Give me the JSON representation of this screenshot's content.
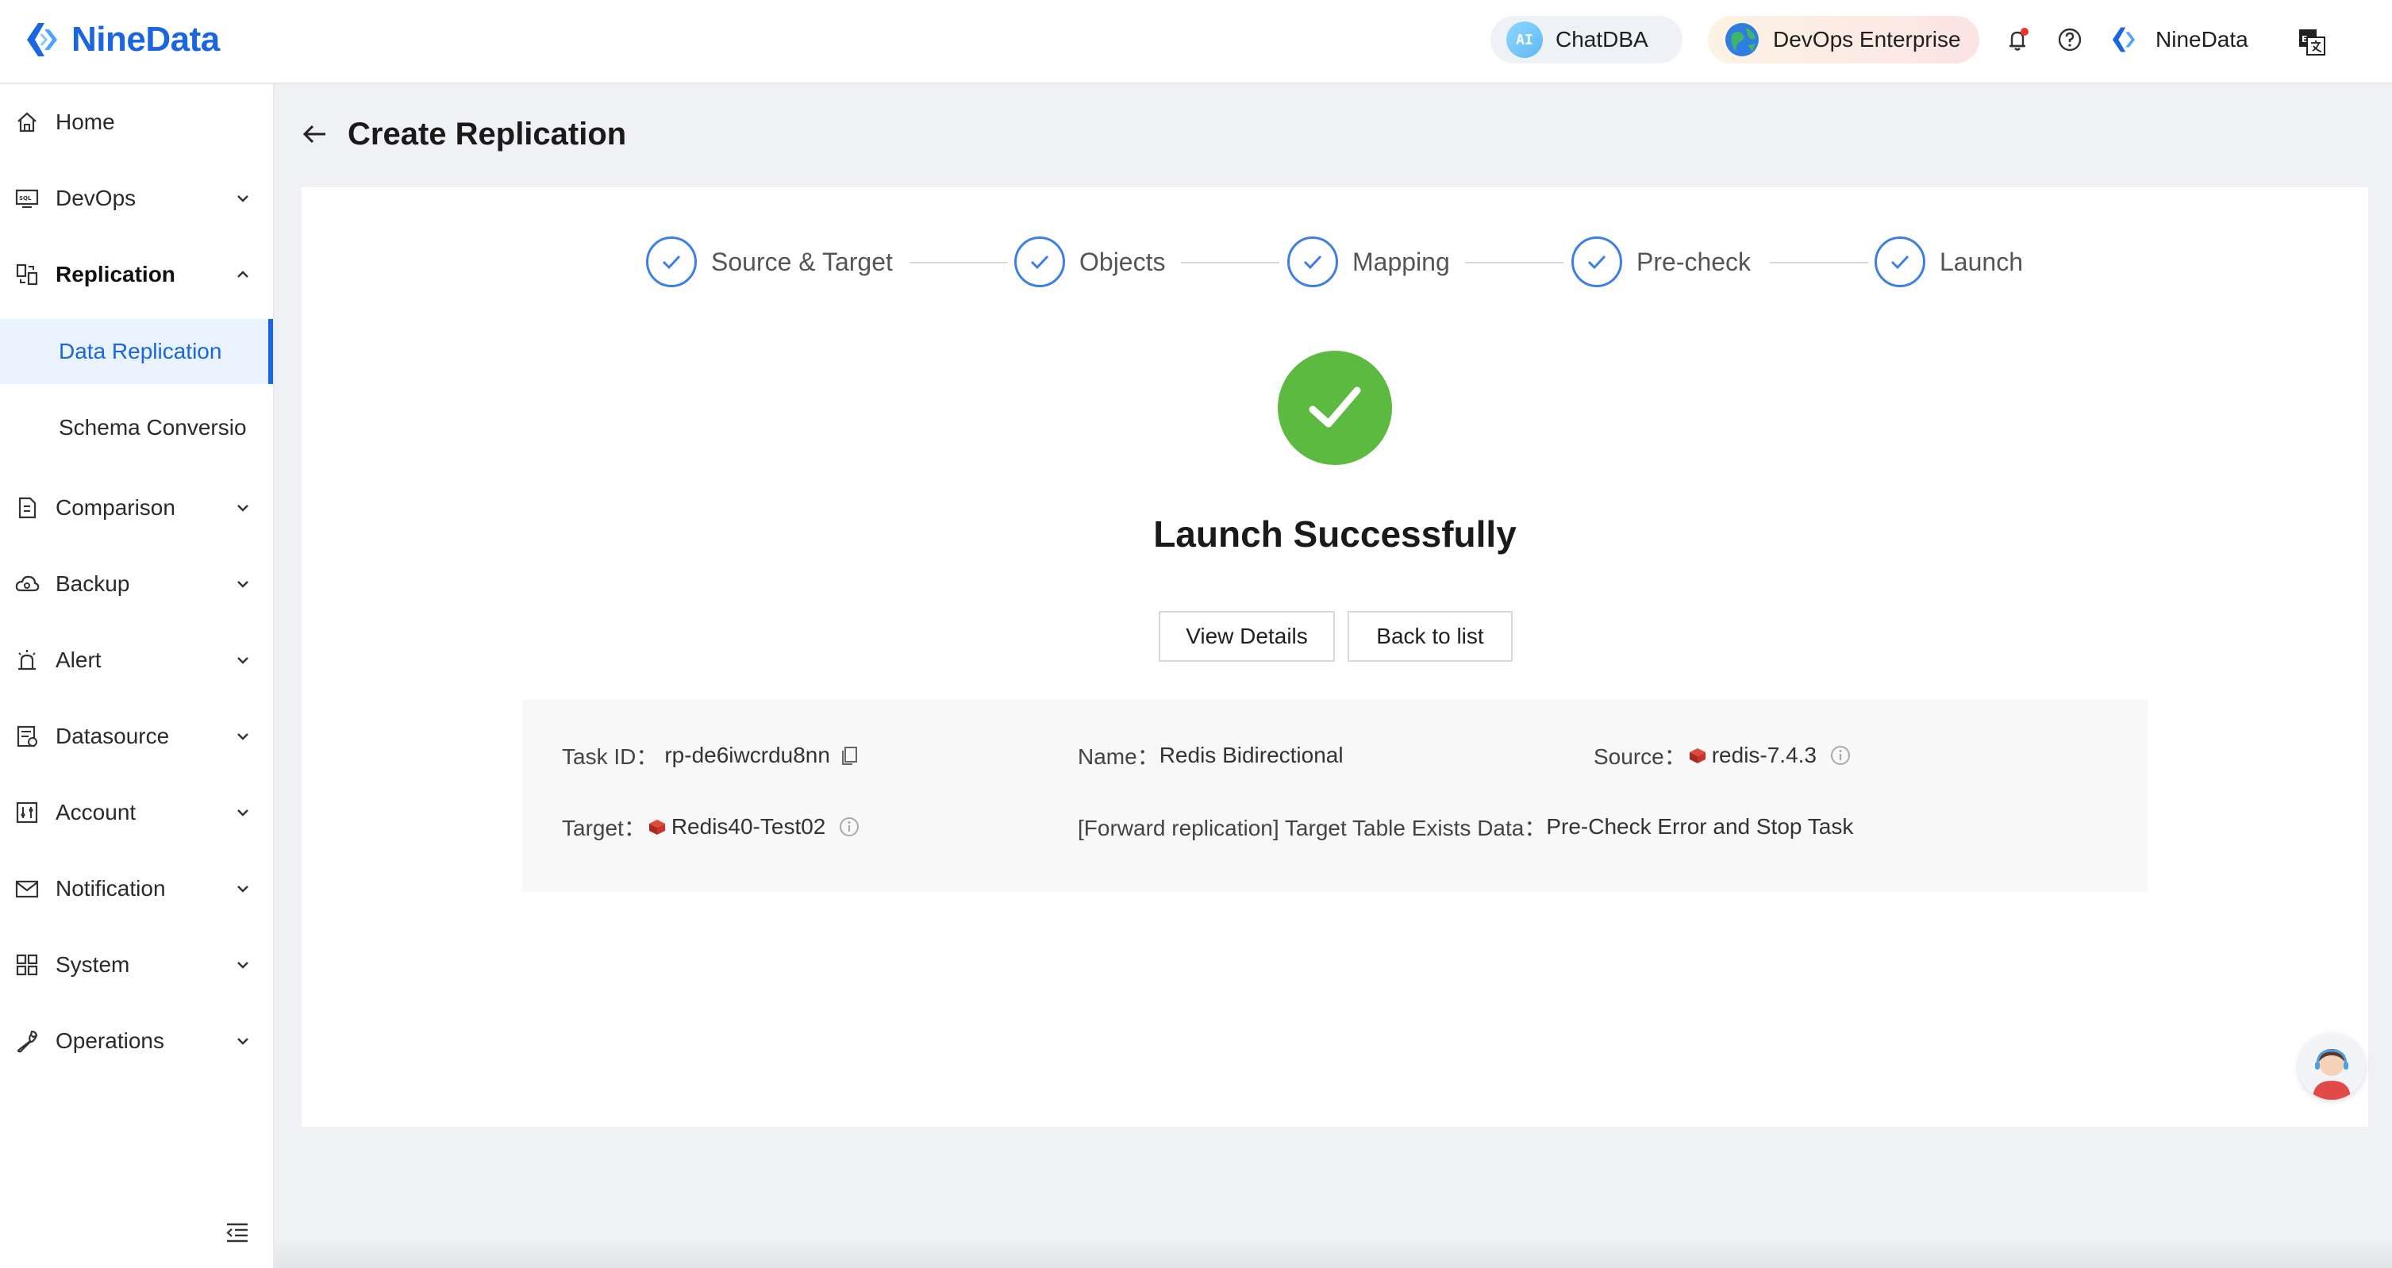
{
  "header": {
    "brand": "NineData",
    "chatdba_label": "ChatDBA",
    "ai_badge": "AI",
    "devops_label": "DevOps Enterprise",
    "user_name": "NineData",
    "icons": [
      "bell-icon",
      "help-icon",
      "language-icon"
    ]
  },
  "sidebar": {
    "items": [
      {
        "label": "Home",
        "icon": "home-icon"
      },
      {
        "label": "DevOps",
        "icon": "sql-console-icon"
      },
      {
        "label": "Replication",
        "icon": "replication-icon"
      },
      {
        "label": "Data Replication"
      },
      {
        "label": "Schema Conversio"
      },
      {
        "label": "Comparison",
        "icon": "comparison-icon"
      },
      {
        "label": "Backup",
        "icon": "cloud-backup-icon"
      },
      {
        "label": "Alert",
        "icon": "alert-icon"
      },
      {
        "label": "Datasource",
        "icon": "datasource-icon"
      },
      {
        "label": "Account",
        "icon": "account-icon"
      },
      {
        "label": "Notification",
        "icon": "mail-icon"
      },
      {
        "label": "System",
        "icon": "grid-icon"
      },
      {
        "label": "Operations",
        "icon": "wrench-icon"
      }
    ]
  },
  "page": {
    "title": "Create Replication"
  },
  "steps": [
    {
      "label": "Source & Target"
    },
    {
      "label": "Objects"
    },
    {
      "label": "Mapping"
    },
    {
      "label": "Pre-check"
    },
    {
      "label": "Launch"
    }
  ],
  "result": {
    "title": "Launch Successfully",
    "view_details": "View Details",
    "back_to_list": "Back to list"
  },
  "details": {
    "task_id_label": "Task ID：",
    "task_id_value": "rp-de6iwcrdu8nn",
    "name_label": "Name：",
    "name_value": "Redis Bidirectional",
    "source_label": "Source：",
    "source_value": "redis-7.4.3",
    "target_label": "Target：",
    "target_value": "Redis40-Test02",
    "forward_label": "[Forward replication] Target Table Exists Data：",
    "forward_value": "Pre-Check Error and Stop Task"
  },
  "colors": {
    "brand_blue": "#1a66e0",
    "success_green": "#5bba3f",
    "redis_red": "#c8332a"
  }
}
